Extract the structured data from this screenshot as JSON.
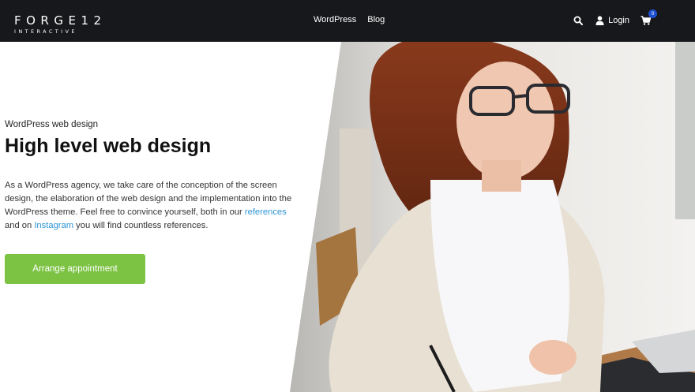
{
  "brand": {
    "name": "FORGE12",
    "tagline": "INTERACTIVE"
  },
  "nav": {
    "items": [
      {
        "label": "WordPress"
      },
      {
        "label": "Blog"
      }
    ]
  },
  "header": {
    "login_label": "Login",
    "cart_count": "0",
    "icons": {
      "search": "search-icon",
      "user": "user-icon",
      "cart": "cart-icon"
    }
  },
  "hero": {
    "eyebrow": "WordPress web design",
    "title": "High level web design",
    "text_before": "As a WordPress agency, we take care of the conception of the screen design, the elaboration of the web design and the implementation into the WordPress theme. Feel free to convince yourself, both in our ",
    "link1": "references",
    "text_middle": " and on ",
    "link2": "Instagram",
    "text_after": " you will find countless references.",
    "cta_label": "Arrange appointment"
  },
  "colors": {
    "header_bg": "#17181b",
    "cta": "#7cc243",
    "link": "#2f95d6",
    "badge": "#1e4fd1"
  }
}
